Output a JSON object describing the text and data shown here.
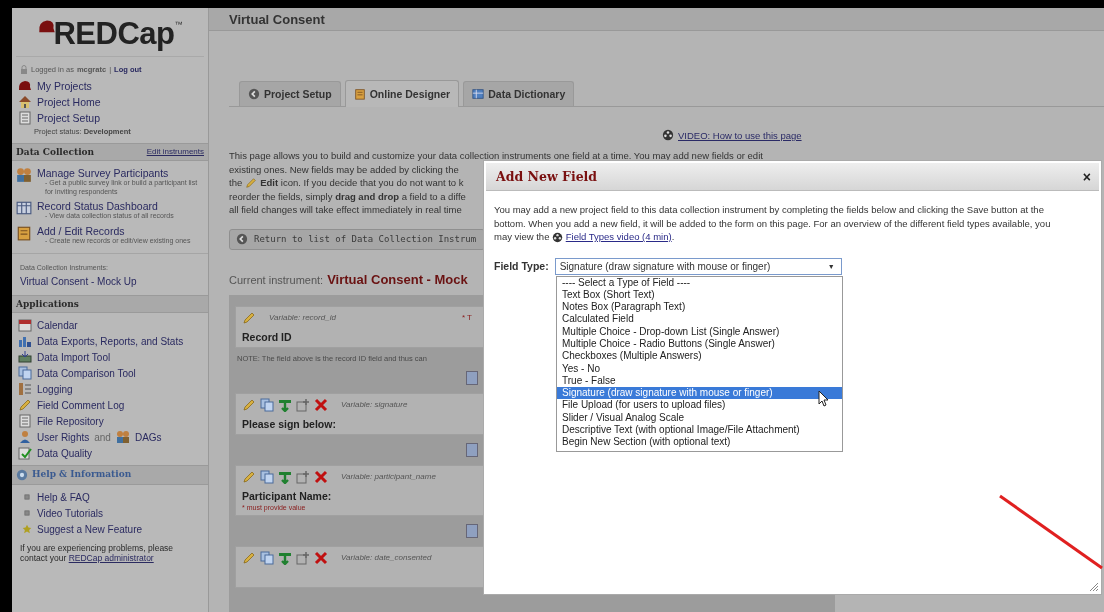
{
  "window": {
    "title": "Virtual Consent"
  },
  "sidebar": {
    "logo": "REDCap",
    "logo_mark": "™",
    "login": {
      "prefix": "Logged in as",
      "user": "mcgratc",
      "separator": "|",
      "logout": "Log out"
    },
    "project_links": [
      "My Projects",
      "Project Home",
      "Project Setup"
    ],
    "project_status": {
      "label": "Project status:",
      "value": "Development"
    },
    "data_collection": {
      "title": "Data Collection",
      "edit_link": "Edit instruments",
      "items": [
        {
          "label": "Manage Survey Participants",
          "description": "- Get a public survey link or build a participant list for inviting respondents"
        },
        {
          "label": "Record Status Dashboard",
          "description": "- View data collection status of all records"
        },
        {
          "label": "Add / Edit Records",
          "description": "- Create new records or edit/view existing ones"
        }
      ]
    },
    "instruments": {
      "label": "Data Collection Instruments:",
      "items": [
        "Virtual Consent - Mock Up"
      ]
    },
    "applications": {
      "title": "Applications",
      "items": [
        {
          "label": "Calendar"
        },
        {
          "label": "Data Exports, Reports, and Stats"
        },
        {
          "label": "Data Import Tool"
        },
        {
          "label": "Data Comparison Tool"
        },
        {
          "label": "Logging"
        },
        {
          "label": "Field Comment Log"
        },
        {
          "label": "File Repository"
        },
        {
          "label": "User Rights",
          "joiner": "and",
          "label_2": "DAGs"
        },
        {
          "label": "Data Quality"
        }
      ]
    },
    "help": {
      "title": "Help & Information",
      "items": [
        "Help & FAQ",
        "Video Tutorials",
        "Suggest a New Feature"
      ]
    },
    "footer": {
      "text": "If you are experiencing problems, please contact your",
      "link": "REDCap administrator"
    }
  },
  "main": {
    "tabs": [
      {
        "label": "Project Setup",
        "selected": false
      },
      {
        "label": "Online Designer",
        "selected": true
      },
      {
        "label": "Data Dictionary",
        "selected": false
      }
    ],
    "video_link": "VIDEO: How to use this page",
    "intro_lines": [
      "This page allows you to build and customize your data collection instruments one field at a time. You may add new fields or edit",
      "existing ones. New fields may be added by clicking the"
    ],
    "edit_line": {
      "before": "the",
      "after": "**Edit** icon. If you decide that you do not want to k"
    },
    "more_lines": [
      "reorder the fields, simply **drag and drop** a field to a diffe",
      "all field changes will take effect immediately in real time"
    ],
    "return_button": "Return to list of Data Collection Instrum",
    "current_instrument": {
      "label": "Current instrument:",
      "name": "Virtual Consent - Mock"
    },
    "fields": [
      {
        "kind": "identifier",
        "variable": "Variable: record_id",
        "flag": "* T",
        "label": "Record ID",
        "note": "NOTE: The field above is the record ID field and thus can"
      },
      {
        "kind": "standard",
        "variable": "Variable: signature",
        "label": "Please sign below:"
      },
      {
        "kind": "standard",
        "variable": "Variable: participant_name",
        "label": "Participant Name:",
        "required": "* must provide value"
      },
      {
        "kind": "standard",
        "variable": "Variable: date_consented"
      }
    ]
  },
  "dialog": {
    "title": "Add New Field",
    "close": "×",
    "intro": "You may add a new project field to this data collection instrument by completing the fields below and clicking the Save button at the bottom. When you add a new field, it will be added to the form on this page. For an overview of the different field types available, you may view the",
    "video_link": "Field Types video (4 min)",
    "intro_end": ".",
    "field_type": {
      "label": "Field Type:",
      "value": "Signature (draw signature with mouse or finger)",
      "arrow": "▼",
      "options": [
        {
          "label": "---- Select a Type of Field ----",
          "selected": false
        },
        {
          "label": "Text Box (Short Text)",
          "selected": false
        },
        {
          "label": "Notes Box (Paragraph Text)",
          "selected": false
        },
        {
          "label": "Calculated Field",
          "selected": false
        },
        {
          "label": "Multiple Choice - Drop-down List (Single Answer)",
          "selected": false
        },
        {
          "label": "Multiple Choice - Radio Buttons (Single Answer)",
          "selected": false
        },
        {
          "label": "Checkboxes (Multiple Answers)",
          "selected": false
        },
        {
          "label": "Yes - No",
          "selected": false
        },
        {
          "label": "True - False",
          "selected": false
        },
        {
          "label": "Signature (draw signature with mouse or finger)",
          "selected": true
        },
        {
          "label": "File Upload (for users to upload files)",
          "selected": false
        },
        {
          "label": "Slider / Visual Analog Scale",
          "selected": false
        },
        {
          "label": "Descriptive Text (with optional Image/File Attachment)",
          "selected": false
        },
        {
          "label": "Begin New Section (with optional text)",
          "selected": false
        }
      ]
    }
  }
}
